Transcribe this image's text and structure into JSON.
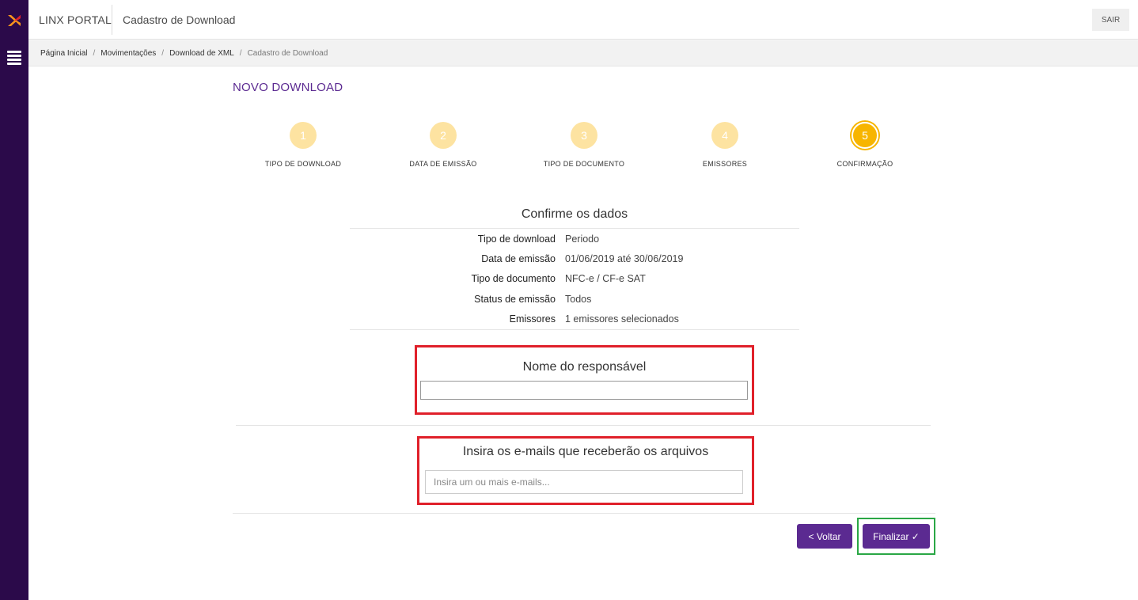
{
  "app": {
    "brand": "LINX PORTAL",
    "page_heading": "Cadastro de Download",
    "logout_label": "SAIR",
    "accent_color": "#5b2a91",
    "sidebar_color": "#2b0a4a",
    "step_color": "#f7b500"
  },
  "breadcrumb": {
    "items": [
      "Página Inicial",
      "Movimentações",
      "Download de XML"
    ],
    "current": "Cadastro de Download",
    "separator": "/"
  },
  "section_title": "NOVO DOWNLOAD",
  "steps": [
    {
      "number": "1",
      "label": "TIPO DE DOWNLOAD"
    },
    {
      "number": "2",
      "label": "DATA DE EMISSÃO"
    },
    {
      "number": "3",
      "label": "TIPO DE DOCUMENTO"
    },
    {
      "number": "4",
      "label": "EMISSORES"
    },
    {
      "number": "5",
      "label": "CONFIRMAÇÃO"
    }
  ],
  "active_step": "5",
  "confirm": {
    "title": "Confirme os dados",
    "rows": [
      {
        "key": "Tipo de download",
        "value": "Periodo"
      },
      {
        "key": "Data de emissão",
        "value": "01/06/2019 até 30/06/2019"
      },
      {
        "key": "Tipo de documento",
        "value": "NFC-e / CF-e SAT"
      },
      {
        "key": "Status de emissão",
        "value": "Todos"
      },
      {
        "key": "Emissores",
        "value": "1 emissores selecionados"
      }
    ]
  },
  "responsible": {
    "title": "Nome do responsável",
    "value": ""
  },
  "emails": {
    "title": "Insira os e-mails que receberão os arquivos",
    "placeholder": "Insira um ou mais e-mails..."
  },
  "actions": {
    "back_label": "< Voltar",
    "finish_label": "Finalizar ✓"
  },
  "icons": [
    "linx-logo-icon",
    "menu-icon"
  ]
}
